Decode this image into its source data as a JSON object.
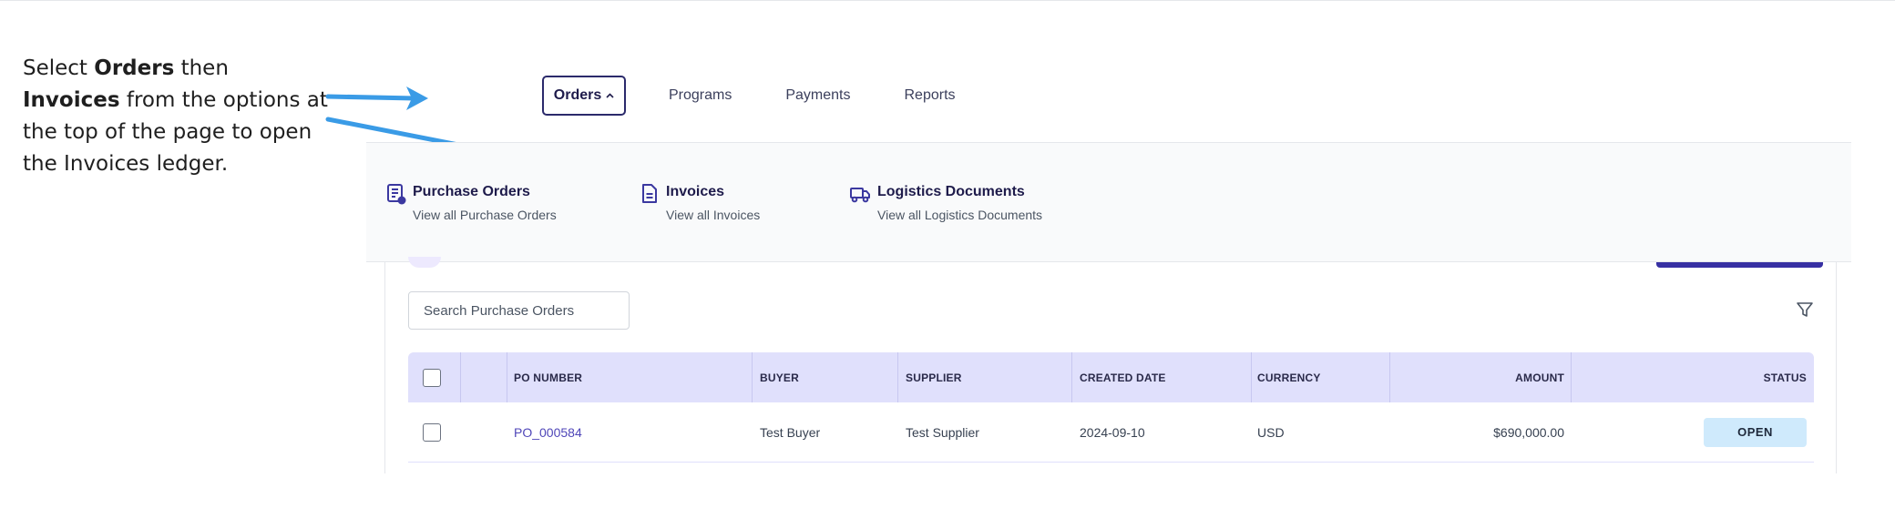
{
  "instruction": {
    "p1": "Select ",
    "b1": "Orders",
    "p2": " then ",
    "b2": "Invoices",
    "p3": " from the options at the top of the page to open the Invoices ledger."
  },
  "nav": {
    "items": [
      {
        "label": "Orders",
        "active": true,
        "icon": "chevron-up-icon"
      },
      {
        "label": "Programs"
      },
      {
        "label": "Payments"
      },
      {
        "label": "Reports"
      }
    ]
  },
  "menu": {
    "items": [
      {
        "title": "Purchase Orders",
        "subtitle": "View all Purchase Orders",
        "icon": "purchase-orders-icon"
      },
      {
        "title": "Invoices",
        "subtitle": "View all Invoices",
        "icon": "invoice-document-icon"
      },
      {
        "title": "Logistics Documents",
        "subtitle": "View all Logistics Documents",
        "icon": "truck-icon"
      }
    ]
  },
  "search": {
    "placeholder": "Search Purchase Orders"
  },
  "table": {
    "columns": [
      "PO NUMBER",
      "BUYER",
      "SUPPLIER",
      "CREATED DATE",
      "CURRENCY",
      "AMOUNT",
      "STATUS"
    ],
    "rows": [
      {
        "po_number": "PO_000584",
        "buyer": "Test Buyer",
        "supplier": "Test Supplier",
        "created_date": "2024-09-10",
        "currency": "USD",
        "amount": "$690,000.00",
        "status": "OPEN"
      }
    ]
  },
  "colors": {
    "accent": "#2b2a6b",
    "arrow": "#3a9be6",
    "header_bg": "#e0e0fc",
    "status_open_bg": "#cfeafc",
    "link": "#4f46b8"
  }
}
